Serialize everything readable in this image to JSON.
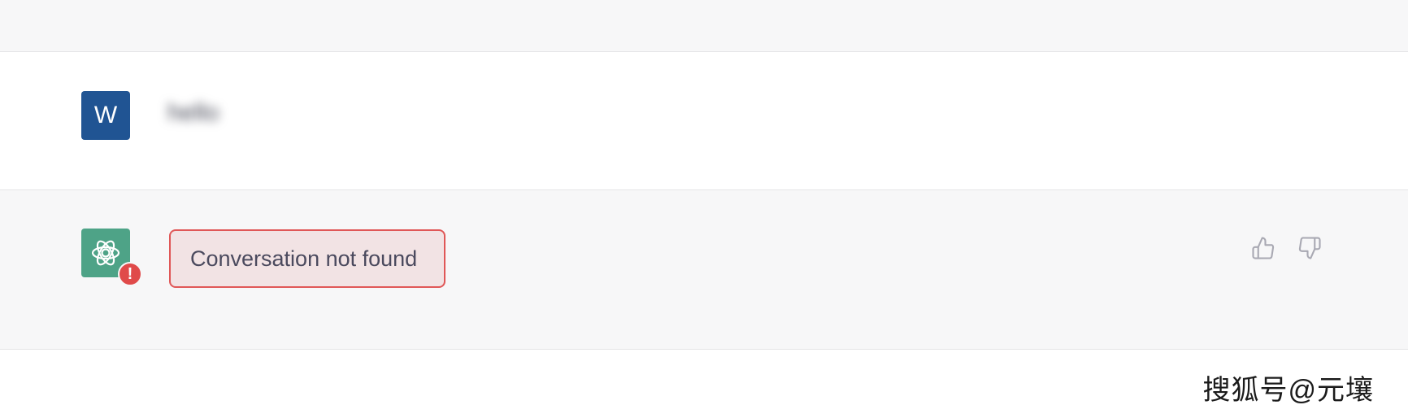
{
  "user_message": {
    "avatar_letter": "W",
    "text": "hello"
  },
  "assistant_message": {
    "error_text": "Conversation not found",
    "error_badge": "!"
  },
  "feedback": {
    "like_icon": "thumbs-up-icon",
    "dislike_icon": "thumbs-down-icon"
  },
  "watermark": "搜狐号@元壤",
  "colors": {
    "user_avatar": "#205493",
    "assistant_avatar": "#4ea387",
    "error_border": "#e05757",
    "error_background": "#f2e3e4",
    "error_badge": "#e04a4a"
  }
}
